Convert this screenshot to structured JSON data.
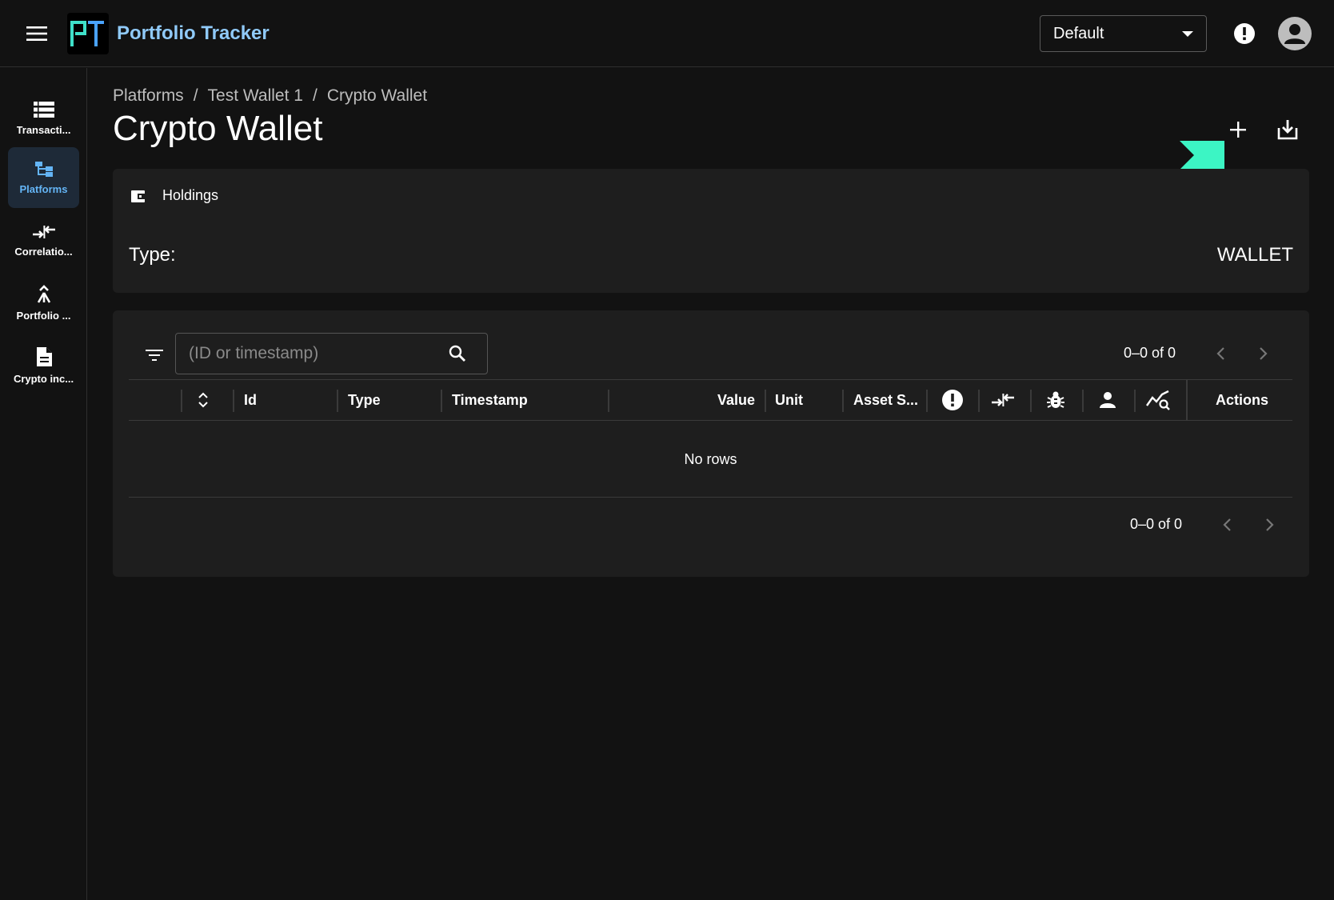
{
  "header": {
    "app_title": "Portfolio Tracker",
    "logo_text": "PT",
    "profile_selected": "Default"
  },
  "sidebar": {
    "items": [
      {
        "label": "Transacti...",
        "icon": "list-icon"
      },
      {
        "label": "Platforms",
        "icon": "platform-tree-icon",
        "active": true
      },
      {
        "label": "Correlatio...",
        "icon": "correlation-icon"
      },
      {
        "label": "Portfolio ...",
        "icon": "merge-icon"
      },
      {
        "label": "Crypto inc...",
        "icon": "document-icon"
      }
    ]
  },
  "breadcrumb": [
    "Platforms",
    "/",
    "Test Wallet 1",
    "/",
    "Crypto Wallet"
  ],
  "page": {
    "title": "Crypto Wallet"
  },
  "holdings": {
    "title": "Holdings",
    "type_label": "Type:",
    "type_value": "WALLET"
  },
  "table": {
    "search_placeholder": "(ID or timestamp)",
    "pager_top": "0–0 of 0",
    "pager_bottom": "0–0 of 0",
    "columns": [
      "Id",
      "Type",
      "Timestamp",
      "Value",
      "Unit",
      "Asset S...",
      "Actions"
    ],
    "empty_text": "No rows"
  },
  "colors": {
    "accent_blue": "#90caf9",
    "arrow_annotation": "#3cf5c4",
    "background": "#121212",
    "card": "#1e1e1e"
  }
}
